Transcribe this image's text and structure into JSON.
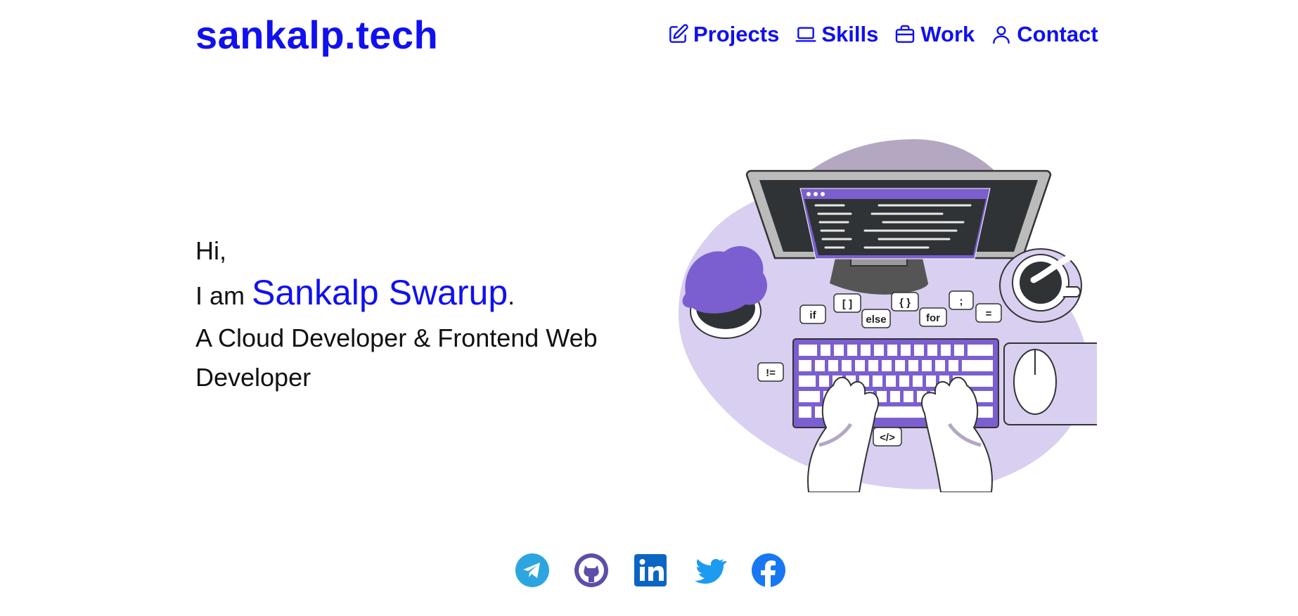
{
  "brand": "sankalp.tech",
  "nav": {
    "projects": "Projects",
    "skills": "Skills",
    "work": "Work",
    "contact": "Contact"
  },
  "hero": {
    "greeting": "Hi,",
    "intro_prefix": "I am ",
    "name": "Sankalp Swarup",
    "name_suffix": ".",
    "role": "A Cloud Developer & Frontend Web Developer"
  },
  "illustration": {
    "code_bubbles": [
      "if",
      "[ ]",
      "else",
      "{ }",
      "for",
      ";",
      "=",
      "!=",
      "</>"
    ]
  },
  "social": [
    "telegram-icon",
    "github-icon",
    "linkedin-icon",
    "twitter-icon",
    "facebook-icon"
  ],
  "colors": {
    "accent": "#1010f0",
    "illustration_purple": "#7b5fd0",
    "illustration_lavender": "#d9cff0"
  }
}
